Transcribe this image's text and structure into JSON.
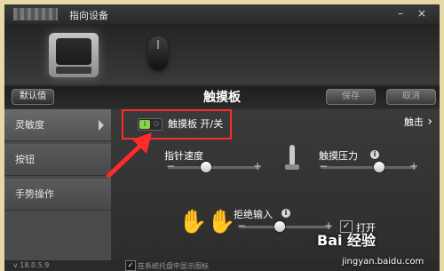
{
  "window": {
    "title": "指向设备",
    "minimize": "–",
    "close": "×"
  },
  "toolbar": {
    "default_label": "默认值",
    "page_title": "触摸板",
    "save_label": "保存",
    "cancel_label": "取消"
  },
  "sidebar": {
    "items": [
      {
        "label": "灵敏度",
        "active": true
      },
      {
        "label": "按钮",
        "active": false
      },
      {
        "label": "手势操作",
        "active": false
      }
    ]
  },
  "content": {
    "toggle": {
      "on": "I",
      "off": "O",
      "label": "触摸板 开/关"
    },
    "touch_link": "触击",
    "pointer_speed": {
      "label": "指针速度",
      "value_fraction": 0.35
    },
    "touch_pressure": {
      "label": "触摸压力",
      "value_fraction": 0.62
    },
    "palm_reject": {
      "label": "拒绝输入",
      "value_fraction": 0.4,
      "checkbox_label": "打开",
      "checked": true
    }
  },
  "status": {
    "version": "v 18.0.5.9",
    "tray_label": "在系统托盘中显示图标"
  },
  "watermark": {
    "text": "Bai 经验",
    "url": "jingyan.baidu.com"
  },
  "colors": {
    "accent_red": "#ff2a2a",
    "toggle_green": "#8bd34c",
    "frame": "#e7d9a6"
  },
  "icons": {
    "info": "info-icon",
    "pressure": "pressure-icon",
    "palm": "palm-icon"
  },
  "symbols": {
    "minus": "−",
    "plus": "+",
    "info": "i",
    "check": "✓"
  }
}
